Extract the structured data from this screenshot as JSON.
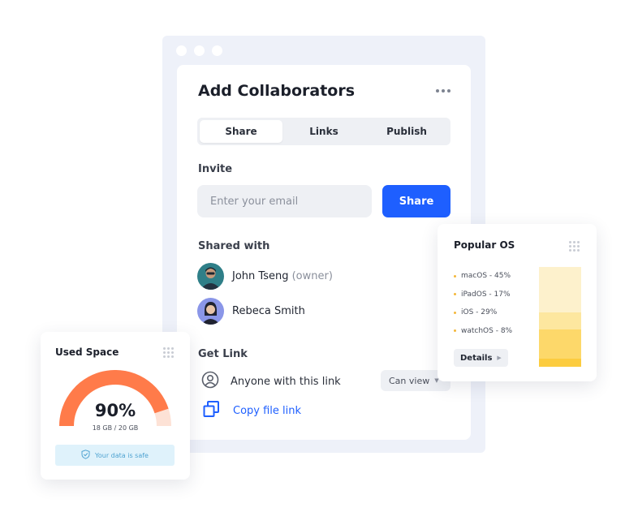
{
  "window": {
    "title": "Add Collaborators",
    "tabs": [
      {
        "label": "Share",
        "active": true
      },
      {
        "label": "Links",
        "active": false
      },
      {
        "label": "Publish",
        "active": false
      }
    ],
    "invite": {
      "label": "Invite",
      "placeholder": "Enter your email",
      "button": "Share"
    },
    "shared_with": {
      "label": "Shared with",
      "people": [
        {
          "name": "John Tseng",
          "role": "(owner)"
        },
        {
          "name": "Rebeca Smith",
          "role": ""
        }
      ]
    },
    "get_link": {
      "label": "Get Link",
      "access_text": "Anyone with this link",
      "permission": "Can view",
      "copy_text": "Copy file link"
    }
  },
  "popular_os": {
    "title": "Popular OS",
    "items": [
      {
        "label": "macOS - 45%",
        "share": 45,
        "color": "#fdf1cc"
      },
      {
        "label": "iPadOS - 17%",
        "share": 17,
        "color": "#fde79f"
      },
      {
        "label": "iOS - 29%",
        "share": 29,
        "color": "#fdd86a"
      },
      {
        "label": "watchOS - 8%",
        "share": 8,
        "color": "#fccc3f"
      }
    ],
    "details_button": "Details"
  },
  "used_space": {
    "title": "Used Space",
    "percent_label": "90%",
    "percent": 0.9,
    "usage": "18 GB / 20 GB",
    "status": "Your data is safe",
    "accent": "#ff7b4a"
  },
  "colors": {
    "primary": "#1e5fff",
    "window_bg": "#eef1f9"
  }
}
